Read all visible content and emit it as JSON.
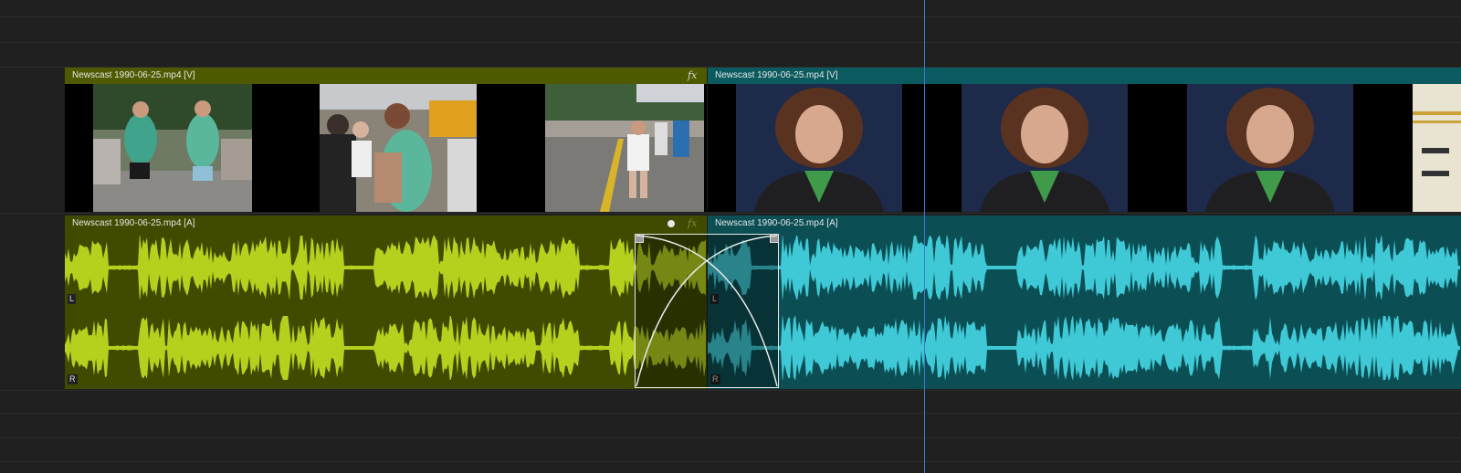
{
  "tracks": {
    "video": {
      "clip_a": {
        "name": "Newscast 1990-06-25.mp4 [V]",
        "fx": "fx",
        "color": "#4f5a00"
      },
      "clip_b": {
        "name": "Newscast 1990-06-25.mp4 [V]",
        "color": "#0b5a60"
      }
    },
    "audio": {
      "clip_a": {
        "name": "Newscast 1990-06-25.mp4 [A]",
        "fx": "fx",
        "waveform_color": "#b5d11e",
        "channel_left": "L",
        "channel_right": "R"
      },
      "clip_b": {
        "name": "Newscast 1990-06-25.mp4 [A]",
        "waveform_color": "#3fc9d6",
        "channel_left": "L",
        "channel_right": "R"
      }
    }
  },
  "thumbnails_a": [
    {
      "icon": "runners-thumbnail"
    },
    {
      "icon": "crowd-thumbnail"
    },
    {
      "icon": "street-race-thumbnail"
    }
  ],
  "thumbnails_b": [
    {
      "icon": "anchor-thumbnail"
    },
    {
      "icon": "anchor-thumbnail"
    },
    {
      "icon": "anchor-thumbnail"
    },
    {
      "icon": "graphic-thumbnail"
    }
  ],
  "transition": {
    "type": "audio-crossfade"
  },
  "colors": {
    "playhead": "#3b7bd4",
    "background": "#1f1f1f"
  }
}
